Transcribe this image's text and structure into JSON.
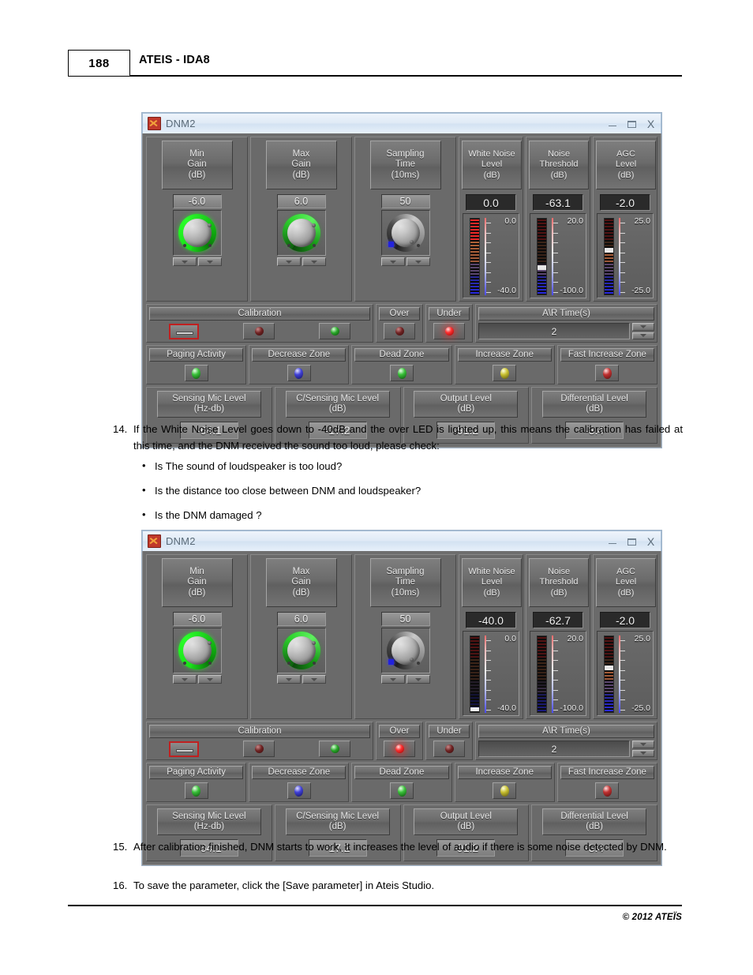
{
  "header": {
    "page_number": "188",
    "title": "ATEIS - IDA8"
  },
  "footer": {
    "copyright": "© 2012 ATEÏS"
  },
  "paragraphs": {
    "p14_num": "14.",
    "p14_text": "If the White Noise Level goes down to -40dB and the over LED is lighted up, this means the calibration has failed at this time, and the DNM received the sound too loud, please check:",
    "bullets": [
      "Is The sound of loudspeaker is too loud?",
      "Is the distance  too close between DNM and loudspeaker?",
      "Is the DNM damaged ?"
    ],
    "p15_num": "15.",
    "p15_text": "After calibration finished, DNM starts to work, It increases the level of audio if there is some noise detected by DNM.",
    "p16_num": "16.",
    "p16_text": "To save the parameter, click the [Save parameter] in Ateis Studio."
  },
  "window1": {
    "title": "DNM2",
    "titlebar_buttons": {
      "minimize": "minimize-icon",
      "maximize": "maximize-icon",
      "close": "X"
    },
    "min_gain": {
      "label": "Min\nGain\n(dB)",
      "l1": "Min",
      "l2": "Gain",
      "l3": "(dB)",
      "value": "-6.0",
      "knob": "green"
    },
    "max_gain": {
      "label": "Max Gain (dB)",
      "l1": "Max",
      "l2": "Gain",
      "l3": "(dB)",
      "value": "6.0",
      "knob": "green-dim"
    },
    "sampling": {
      "label": "Sampling Time",
      "l1": "Sampling",
      "l2": "Time",
      "l3": "(10ms)",
      "value": "50",
      "knob": "dark"
    },
    "white_noise": {
      "l1": "White Noise",
      "l2": "Level",
      "l3": "(dB)",
      "value": "0.0",
      "scale_top": "0.0",
      "scale_bottom": "-40.0",
      "meter_fill": 100,
      "lit": true
    },
    "noise_threshold": {
      "l1": "Noise",
      "l2": "Threshold",
      "l3": "(dB)",
      "value": "-63.1",
      "scale_top": "20.0",
      "scale_bottom": "-100.0",
      "meter_fill": 32,
      "lit": true
    },
    "agc_level": {
      "l1": "AGC",
      "l2": "Level",
      "l3": "(dB)",
      "value": "-2.0",
      "scale_top": "25.0",
      "scale_bottom": "-25.0",
      "meter_fill": 55,
      "lit": true
    },
    "calibration": {
      "label": "Calibration",
      "button": "calibration-dash-button",
      "led1": "reddim",
      "led2": "green"
    },
    "over": {
      "label": "Over",
      "led": "reddim"
    },
    "under": {
      "label": "Under",
      "led": "redlit"
    },
    "ar_time": {
      "label": "A\\R Time(s)",
      "value": "2"
    },
    "zones": [
      {
        "label": "Paging Activity",
        "led": "green"
      },
      {
        "label": "Decrease Zone",
        "led": "blue"
      },
      {
        "label": "Dead Zone",
        "led": "green"
      },
      {
        "label": "Increase Zone",
        "led": "yellow"
      },
      {
        "label": "Fast Increase Zone",
        "led": "red"
      }
    ],
    "levels": [
      {
        "l1": "Sensing Mic Level",
        "l2": "(Hz-db)",
        "value": "-64.1"
      },
      {
        "l1": "C/Sensing Mic Level",
        "l2": "(dB)",
        "value": "-17.2"
      },
      {
        "l1": "Output Level",
        "l2": "(dB)",
        "value": "-91.2"
      },
      {
        "l1": "Differential Level",
        "l2": "(dB)",
        "value": "-3.4"
      }
    ]
  },
  "window2": {
    "title": "DNM2",
    "titlebar_buttons": {
      "minimize": "minimize-icon",
      "maximize": "maximize-icon",
      "close": "X"
    },
    "min_gain": {
      "l1": "Min",
      "l2": "Gain",
      "l3": "(dB)",
      "value": "-6.0",
      "knob": "green"
    },
    "max_gain": {
      "l1": "Max",
      "l2": "Gain",
      "l3": "(dB)",
      "value": "6.0",
      "knob": "green-dim"
    },
    "sampling": {
      "l1": "Sampling",
      "l2": "Time",
      "l3": "(10ms)",
      "value": "50",
      "knob": "dark"
    },
    "white_noise": {
      "l1": "White Noise",
      "l2": "Level",
      "l3": "(dB)",
      "value": "-40.0",
      "scale_top": "0.0",
      "scale_bottom": "-40.0",
      "meter_fill": 4,
      "lit": false
    },
    "noise_threshold": {
      "l1": "Noise",
      "l2": "Threshold",
      "l3": "(dB)",
      "value": "-62.7",
      "scale_top": "20.0",
      "scale_bottom": "-100.0",
      "meter_fill": 33,
      "lit": false
    },
    "agc_level": {
      "l1": "AGC",
      "l2": "Level",
      "l3": "(dB)",
      "value": "-2.0",
      "scale_top": "25.0",
      "scale_bottom": "-25.0",
      "meter_fill": 55,
      "lit": true
    },
    "calibration": {
      "label": "Calibration",
      "button": "calibration-dash-button",
      "led1": "reddim",
      "led2": "green"
    },
    "over": {
      "label": "Over",
      "led": "redlit"
    },
    "under": {
      "label": "Under",
      "led": "reddim"
    },
    "ar_time": {
      "label": "A\\R Time(s)",
      "value": "2"
    },
    "zones": [
      {
        "label": "Paging Activity",
        "led": "green"
      },
      {
        "label": "Decrease Zone",
        "led": "blue"
      },
      {
        "label": "Dead Zone",
        "led": "green"
      },
      {
        "label": "Increase Zone",
        "led": "yellow"
      },
      {
        "label": "Fast Increase Zone",
        "led": "red"
      }
    ],
    "levels": [
      {
        "l1": "Sensing Mic Level",
        "l2": "(Hz-db)",
        "value": "-64.1"
      },
      {
        "l1": "C/Sensing Mic Level",
        "l2": "(dB)",
        "value": "-17.2"
      },
      {
        "l1": "Output Level",
        "l2": "(dB)",
        "value": "-91.2"
      },
      {
        "l1": "Differential Level",
        "l2": "(dB)",
        "value": "-3.4"
      }
    ]
  }
}
